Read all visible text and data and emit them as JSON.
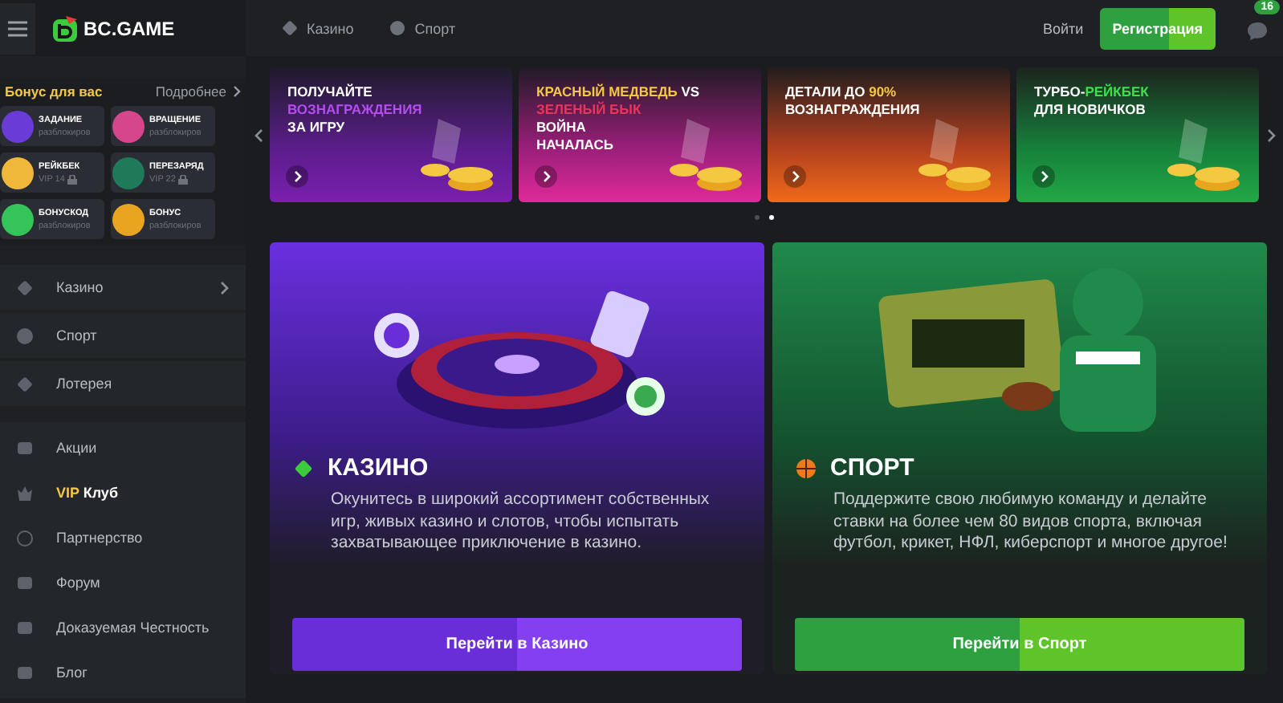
{
  "header": {
    "logo": "BC.GAME",
    "nav": [
      {
        "label": "Казино",
        "kind": "casino"
      },
      {
        "label": "Спорт",
        "kind": "sport"
      }
    ],
    "login": "Войти",
    "register": "Регистрация",
    "chat_badge": "16"
  },
  "bonus": {
    "title": "Бонус для вас",
    "more": "Подробнее",
    "tiles": [
      {
        "title": "ЗАДАНИЕ",
        "subtitle": "разблокиров",
        "locked": false,
        "kind": "target"
      },
      {
        "title": "ВРАЩЕНИЕ",
        "subtitle": "разблокиров",
        "locked": false,
        "kind": "wheel"
      },
      {
        "title": "РЕЙКБЕК",
        "subtitle": "VIP 14",
        "locked": true,
        "kind": "piggy"
      },
      {
        "title": "ПЕРЕЗАРЯД",
        "subtitle": "VIP 22",
        "locked": true,
        "kind": "rocket"
      },
      {
        "title": "БОНУСКОД",
        "subtitle": "разблокиров",
        "locked": false,
        "kind": "tag"
      },
      {
        "title": "БОНУС",
        "subtitle": "разблокиров",
        "locked": false,
        "kind": "coin"
      }
    ]
  },
  "sidebar": {
    "groups": [
      [
        {
          "label": "Казино",
          "kind": "submenu"
        },
        {
          "label": "Спорт",
          "kind": "link"
        },
        {
          "label": "Лотерея",
          "kind": "link"
        }
      ],
      [
        {
          "label": "Акции",
          "kind": "link"
        },
        {
          "accent": "VIP",
          "label": "Клуб",
          "kind": "vip"
        },
        {
          "label": "Партнерство",
          "kind": "link"
        },
        {
          "label": "Форум",
          "kind": "link"
        },
        {
          "label": "Доказуемая Честность",
          "kind": "link"
        },
        {
          "label": "Блог",
          "kind": "link"
        }
      ]
    ]
  },
  "banners": [
    {
      "lines": [
        [
          {
            "text": "ПОЛУЧАЙТЕ"
          }
        ],
        [
          {
            "text": "ВОЗНАГРАЖДЕНИЯ",
            "color": "#b44cf0"
          }
        ],
        [
          {
            "text": "ЗА ИГРУ"
          }
        ]
      ]
    },
    {
      "lines": [
        [
          {
            "text": "КРАСНЫЙ МЕДВЕДЬ",
            "color": "#f5c842"
          },
          {
            "text": " VS"
          }
        ],
        [
          {
            "text": "ЗЕЛЕНЫЙ БЫК",
            "color": "#e8365a"
          }
        ],
        [
          {
            "text": "ВОЙНА"
          }
        ],
        [
          {
            "text": "НАЧАЛАСЬ"
          }
        ]
      ]
    },
    {
      "lines": [
        [
          {
            "text": "ДЕТАЛИ ДО "
          },
          {
            "text": "90%",
            "color": "#f5c842"
          }
        ],
        [
          {
            "text": "ВОЗНАГРАЖДЕНИЯ"
          }
        ]
      ]
    },
    {
      "lines": [
        [
          {
            "text": "ТУРБО-"
          },
          {
            "text": "РЕЙКБЕК",
            "color": "#3ee04a"
          }
        ],
        [
          {
            "text": "ДЛЯ НОВИЧКОВ"
          }
        ]
      ]
    }
  ],
  "carousel_dots": [
    {
      "selected": false
    },
    {
      "selected": true
    }
  ],
  "cards": [
    {
      "kind": "casino",
      "title": "КАЗИНО",
      "text": "Окунитесь в широкий ассортимент собственных игр, живых казино и слотов, чтобы испытать захватывающее приключение в казино.",
      "button": "Перейти в Казино"
    },
    {
      "kind": "sport",
      "title": "СПОРТ",
      "text": "Поддержите свою любимую команду и делайте ставки на более чем 80 видов спорта, включая футбол, крикет, НФЛ, киберспорт и многое другое!",
      "button": "Перейти в Спорт"
    }
  ]
}
